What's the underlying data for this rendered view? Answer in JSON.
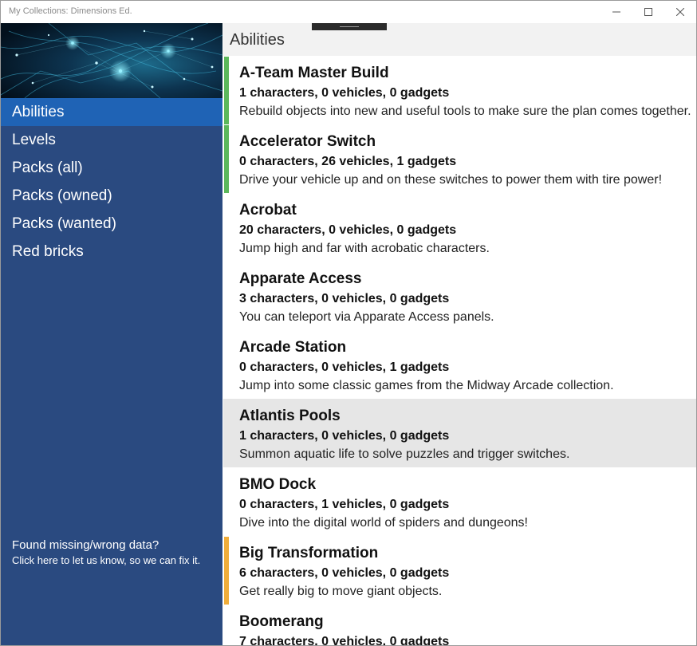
{
  "window": {
    "title": "My Collections: Dimensions Ed."
  },
  "sidebar": {
    "items": [
      {
        "label": "Abilities",
        "active": true
      },
      {
        "label": "Levels",
        "active": false
      },
      {
        "label": "Packs (all)",
        "active": false
      },
      {
        "label": "Packs (owned)",
        "active": false
      },
      {
        "label": "Packs (wanted)",
        "active": false
      },
      {
        "label": "Red bricks",
        "active": false
      }
    ],
    "feedback": {
      "title": "Found missing/wrong data?",
      "subtitle": "Click here to let us know, so we can fix it."
    }
  },
  "main": {
    "title": "Abilities",
    "items": [
      {
        "name": "A-Team Master Build",
        "counts": "1 characters, 0 vehicles, 0 gadgets",
        "description": "Rebuild objects into new and useful tools to make sure the plan comes together.",
        "status": "owned"
      },
      {
        "name": "Accelerator Switch",
        "counts": "0 characters, 26 vehicles, 1 gadgets",
        "description": "Drive your vehicle up and on these switches to power them with tire power!",
        "status": "owned"
      },
      {
        "name": "Acrobat",
        "counts": "20 characters, 0 vehicles, 0 gadgets",
        "description": "Jump high and far with acrobatic characters.",
        "status": "none"
      },
      {
        "name": "Apparate Access",
        "counts": "3 characters, 0 vehicles, 0 gadgets",
        "description": "You can teleport via Apparate Access panels.",
        "status": "none"
      },
      {
        "name": "Arcade Station",
        "counts": "0 characters, 0 vehicles, 1 gadgets",
        "description": "Jump into some classic games from the Midway Arcade collection.",
        "status": "none"
      },
      {
        "name": "Atlantis Pools",
        "counts": "1 characters, 0 vehicles, 0 gadgets",
        "description": "Summon aquatic life to solve puzzles and trigger switches.",
        "status": "none",
        "selected": true
      },
      {
        "name": "BMO Dock",
        "counts": "0 characters, 1 vehicles, 0 gadgets",
        "description": "Dive into the digital world of spiders and dungeons!",
        "status": "none"
      },
      {
        "name": "Big Transformation",
        "counts": "6 characters, 0 vehicles, 0 gadgets",
        "description": "Get really big to move giant objects.",
        "status": "wanted"
      },
      {
        "name": "Boomerang",
        "counts": "7 characters, 0 vehicles, 0 gadgets",
        "description": "",
        "status": "none"
      }
    ]
  },
  "colors": {
    "sidebar_bg": "#2a4a80",
    "nav_active_bg": "#1f63b5",
    "owned_indicator": "#5cb85c",
    "wanted_indicator": "#f0ad3a",
    "selected_row_bg": "#e6e6e6"
  },
  "icons": {
    "minimize": "minimize-icon",
    "maximize": "maximize-icon",
    "close": "close-icon"
  }
}
